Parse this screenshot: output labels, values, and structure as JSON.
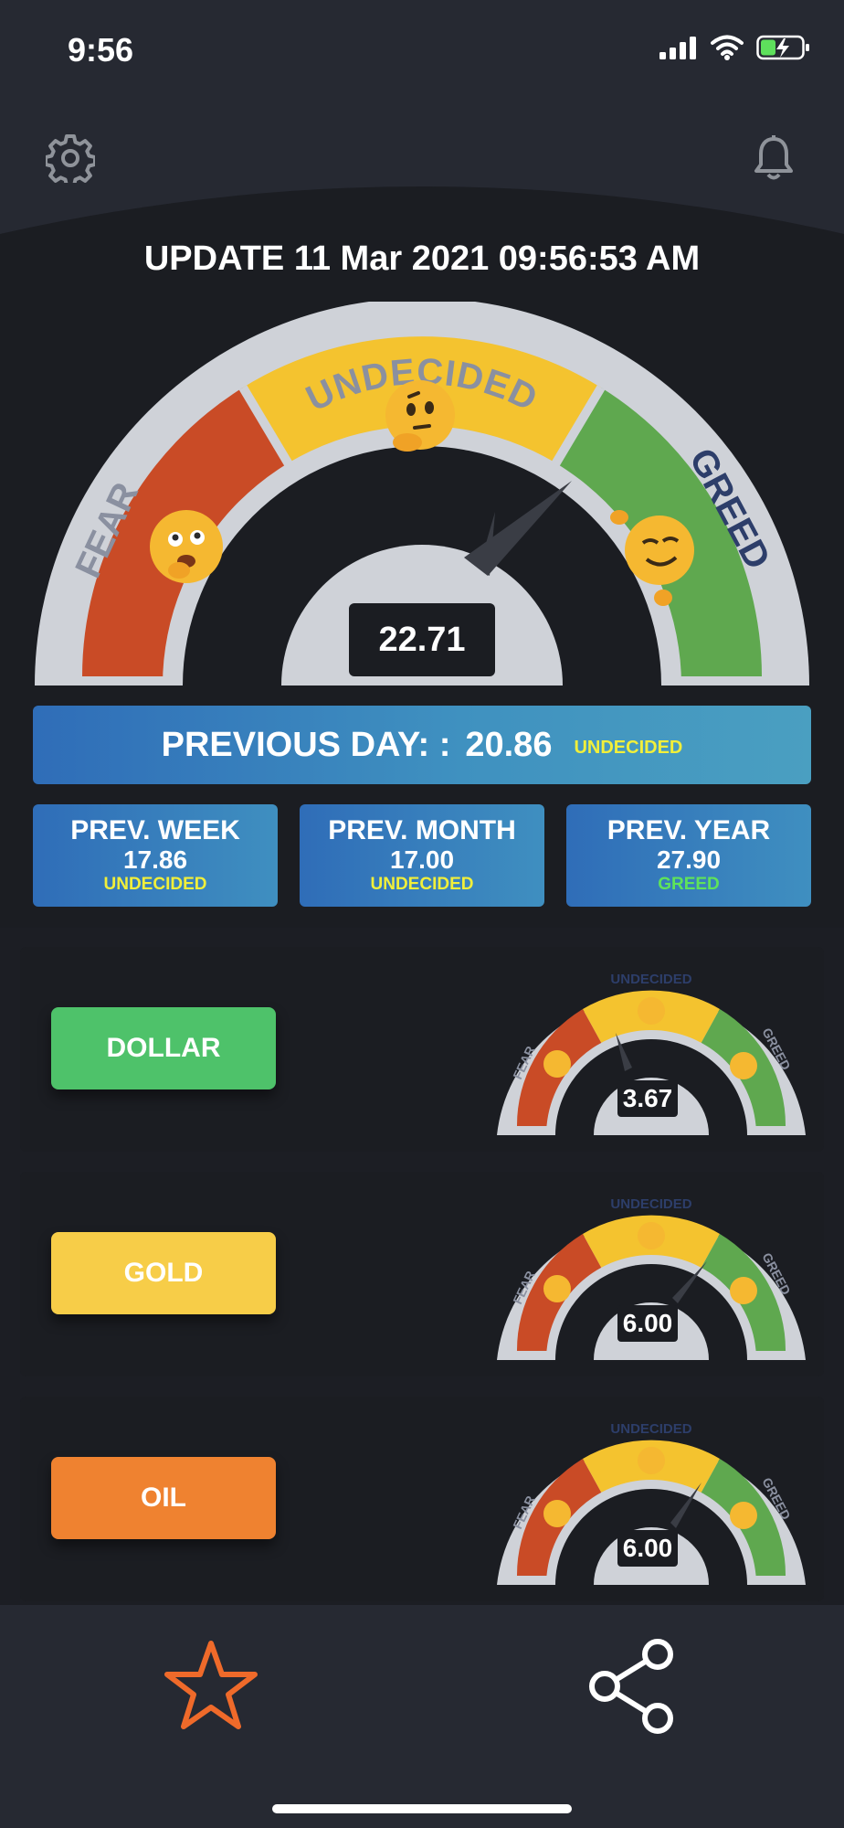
{
  "status_bar": {
    "time": "9:56"
  },
  "header": {
    "settings_icon": "gear-icon",
    "notifications_icon": "bell-icon",
    "update_label": "UPDATE",
    "update_datetime": "11 Mar 2021 09:56:53 AM"
  },
  "gauge": {
    "fear_label": "FEAR",
    "undecided_label": "UNDECIDED",
    "greed_label": "GREED",
    "value": "22.71",
    "colors": {
      "fear": "#c94b26",
      "undecided": "#f4c32f",
      "greed": "#5fa84f",
      "rim": "#cfd2d8"
    }
  },
  "previous_day": {
    "label": "PREVIOUS DAY: :",
    "value": "20.86",
    "status": "UNDECIDED"
  },
  "previous_cards": [
    {
      "label": "PREV. WEEK",
      "value": "17.86",
      "status": "UNDECIDED",
      "status_color": "#f1ef3a"
    },
    {
      "label": "PREV. MONTH",
      "value": "17.00",
      "status": "UNDECIDED",
      "status_color": "#f1ef3a"
    },
    {
      "label": "PREV. YEAR",
      "value": "27.90",
      "status": "GREED",
      "status_color": "#5fe35a"
    }
  ],
  "assets": [
    {
      "label": "DOLLAR",
      "color": "#4ec26a",
      "value": "3.67"
    },
    {
      "label": "GOLD",
      "color": "#f7cd48",
      "value": "6.00"
    },
    {
      "label": "OIL",
      "color": "#ef8230",
      "value": "6.00"
    }
  ],
  "bottom_bar": {
    "favorite_icon": "star-icon",
    "share_icon": "share-icon",
    "accent_color": "#ef6a2a"
  }
}
